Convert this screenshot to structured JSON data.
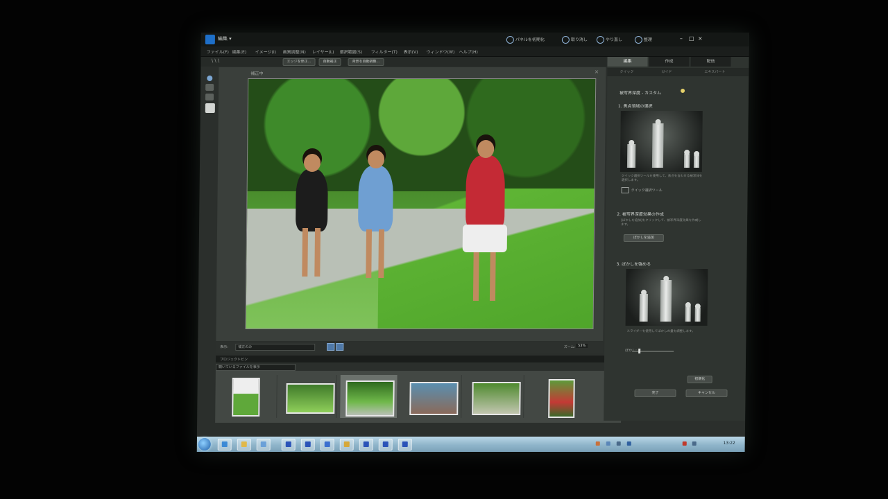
{
  "app": {
    "menu_button": "編集 ▾",
    "title_actions": [
      {
        "label": "パネルを初期化",
        "icon": "reset-icon"
      },
      {
        "label": "取り消し",
        "icon": "undo-icon"
      },
      {
        "label": "やり直し",
        "icon": "redo-icon"
      },
      {
        "label": "整理",
        "icon": "home-icon"
      }
    ],
    "window_controls": [
      "–",
      "□",
      "×"
    ]
  },
  "menubar": [
    "ファイル(F)",
    "編集(E)",
    "イメージ(I)",
    "画質調整(N)",
    "レイヤー(L)",
    "選択範囲(S)",
    "フィルター(T)",
    "表示(V)",
    "ウィンドウ(W)",
    "ヘルプ(H)"
  ],
  "optionbar": {
    "pills": [
      "エッジを修正...",
      "自動補正",
      "背景を自動調整..."
    ]
  },
  "canvas": {
    "title": "補正中",
    "close": "×"
  },
  "canvas_footer": {
    "view_label": "表示:",
    "view_value": "補正のみ",
    "zoom_label": "ズーム:",
    "zoom_value": "53%"
  },
  "bin": {
    "header": "プロジェクトビン",
    "select_value": "開いているファイルを表示"
  },
  "right_panel": {
    "tabs": [
      "編集",
      "作成",
      "配信"
    ],
    "subtabs": [
      "クイック",
      "ガイド",
      "エキスパート"
    ],
    "title": "被写界深度 - カスタム",
    "step1": "1. 焦点領域の選択",
    "step1_hint": "クイック選択ツールを使用して、焦点を合わせる被写体を選択します。",
    "step1_tool": "クイック選択ツール",
    "step2": "2. 被写界深度効果の作成",
    "step2_hint": "[ぼかしを追加]をクリックして、被写界深度効果を作成します。",
    "step2_button": "ぼかしを追加",
    "step3": "3. ぼかしを強める",
    "step3_hint": "スライダーを使用してぼかしの量を調整します。",
    "slider_label": "ぼかし:",
    "reset_button": "初期化",
    "done_button": "完了",
    "cancel_button": "キャンセル"
  },
  "taskbar": {
    "clock": "13:22"
  }
}
